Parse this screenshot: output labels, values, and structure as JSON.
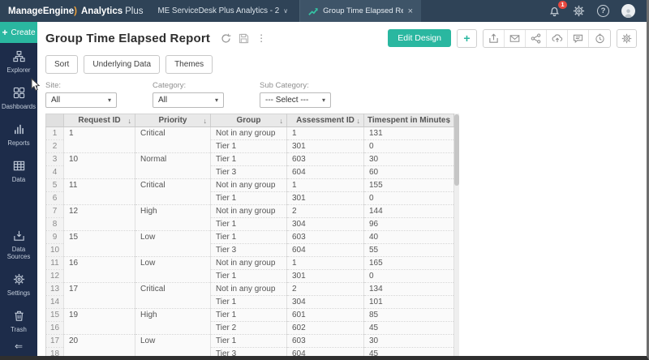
{
  "icons": {
    "chevron_down": "∨",
    "close": "×",
    "kebab": "⋮",
    "plus": "+",
    "help": "?",
    "select_caret": "▾",
    "sort_down": "↓",
    "collapse_left": "⇐"
  },
  "topbar": {
    "brand_name": "ManageEngine",
    "brand_swoosh": ")",
    "product_bold": "Analytics",
    "product_light": "Plus",
    "workspace": "ME ServiceDesk Plus Analytics - 2",
    "tab_label": "Group Time Elapsed Re...",
    "notification_count": "1"
  },
  "sidebar": {
    "create_label": "Create",
    "items": [
      {
        "label": "Explorer"
      },
      {
        "label": "Dashboards"
      },
      {
        "label": "Reports"
      },
      {
        "label": "Data"
      },
      {
        "label": "Data Sources"
      },
      {
        "label": "Settings"
      },
      {
        "label": "Trash"
      }
    ]
  },
  "report": {
    "title": "Group Time Elapsed Report",
    "edit_design_label": "Edit Design",
    "action_buttons": {
      "sort": "Sort",
      "underlying_data": "Underlying Data",
      "themes": "Themes"
    },
    "filters": [
      {
        "label": "Site:",
        "value": "All"
      },
      {
        "label": "Category:",
        "value": "All"
      },
      {
        "label": "Sub Category:",
        "value": "--- Select ---"
      }
    ]
  },
  "table": {
    "columns": [
      "Request ID",
      "Priority",
      "Group",
      "Assessment ID",
      "Timespent in Minutes"
    ],
    "groups": [
      {
        "request_id": "1",
        "priority": "Critical",
        "entries": [
          {
            "num": "1",
            "group": "Not in any group",
            "assessment_id": "1",
            "timespent": "131"
          },
          {
            "num": "2",
            "group": "Tier 1",
            "assessment_id": "301",
            "timespent": "0"
          }
        ]
      },
      {
        "request_id": "10",
        "priority": "Normal",
        "entries": [
          {
            "num": "3",
            "group": "Tier 1",
            "assessment_id": "603",
            "timespent": "30"
          },
          {
            "num": "4",
            "group": "Tier 3",
            "assessment_id": "604",
            "timespent": "60"
          }
        ]
      },
      {
        "request_id": "11",
        "priority": "Critical",
        "entries": [
          {
            "num": "5",
            "group": "Not in any group",
            "assessment_id": "1",
            "timespent": "155"
          },
          {
            "num": "6",
            "group": "Tier 1",
            "assessment_id": "301",
            "timespent": "0"
          }
        ]
      },
      {
        "request_id": "12",
        "priority": "High",
        "entries": [
          {
            "num": "7",
            "group": "Not in any group",
            "assessment_id": "2",
            "timespent": "144"
          },
          {
            "num": "8",
            "group": "Tier 1",
            "assessment_id": "304",
            "timespent": "96"
          }
        ]
      },
      {
        "request_id": "15",
        "priority": "Low",
        "entries": [
          {
            "num": "9",
            "group": "Tier 1",
            "assessment_id": "603",
            "timespent": "40"
          },
          {
            "num": "10",
            "group": "Tier 3",
            "assessment_id": "604",
            "timespent": "55"
          }
        ]
      },
      {
        "request_id": "16",
        "priority": "Low",
        "entries": [
          {
            "num": "11",
            "group": "Not in any group",
            "assessment_id": "1",
            "timespent": "165"
          },
          {
            "num": "12",
            "group": "Tier 1",
            "assessment_id": "301",
            "timespent": "0"
          }
        ]
      },
      {
        "request_id": "17",
        "priority": "Critical",
        "entries": [
          {
            "num": "13",
            "group": "Not in any group",
            "assessment_id": "2",
            "timespent": "134"
          },
          {
            "num": "14",
            "group": "Tier 1",
            "assessment_id": "304",
            "timespent": "101"
          }
        ]
      },
      {
        "request_id": "19",
        "priority": "High",
        "entries": [
          {
            "num": "15",
            "group": "Tier 1",
            "assessment_id": "601",
            "timespent": "85"
          },
          {
            "num": "16",
            "group": "Tier 2",
            "assessment_id": "602",
            "timespent": "45"
          }
        ]
      },
      {
        "request_id": "20",
        "priority": "Low",
        "entries": [
          {
            "num": "17",
            "group": "Tier 1",
            "assessment_id": "603",
            "timespent": "30"
          },
          {
            "num": "18",
            "group": "Tier 3",
            "assessment_id": "604",
            "timespent": "45"
          }
        ]
      }
    ]
  },
  "colors": {
    "topbar_bg": "#2f4357",
    "tab_bg": "#3e5468",
    "sidebar_bg": "#1d2c4a",
    "accent_teal": "#2ab7a0",
    "brand_swoosh_orange": "#f0a23c",
    "badge_red": "#e8483f",
    "table_header_bg": "#e9e9e9"
  }
}
